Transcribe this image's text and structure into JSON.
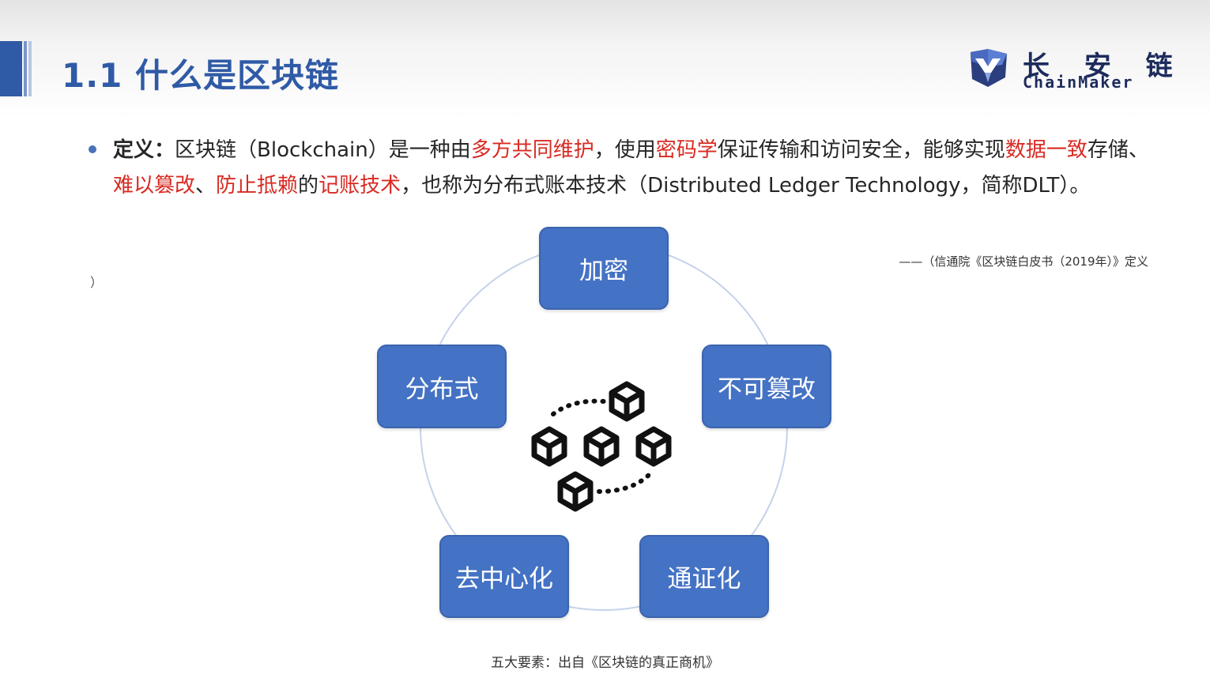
{
  "slide": {
    "title": "1.1 什么是区块链",
    "brand": {
      "name_cn": "长 安 链",
      "name_en": "ChainMaker",
      "logo_icon": "chainmaker-logo-icon",
      "color": "#1d2b5c"
    },
    "accent_color": "#2f5aa6",
    "highlight_color": "#d82a22"
  },
  "definition": {
    "label": "定义：",
    "segments": [
      {
        "text": "区块链（Blockchain）是一种由",
        "highlight": false
      },
      {
        "text": "多方共同维护",
        "highlight": true
      },
      {
        "text": "，使用",
        "highlight": false
      },
      {
        "text": "密码学",
        "highlight": true
      },
      {
        "text": "保证传输和访问安全，能够实现",
        "highlight": false
      },
      {
        "text": "数据一致",
        "highlight": true
      },
      {
        "text": "存储、",
        "highlight": false
      },
      {
        "text": "难以篡改",
        "highlight": true
      },
      {
        "text": "、",
        "highlight": false
      },
      {
        "text": "防止抵赖",
        "highlight": true
      },
      {
        "text": "的",
        "highlight": false
      },
      {
        "text": "记账技术",
        "highlight": true
      },
      {
        "text": "，也称为分布式账本技术（Distributed Ledger Technology，简称DLT）。",
        "highlight": false
      }
    ],
    "source": "——（信通院《区块链白皮书（2019年）》定义",
    "stray_mark": "）"
  },
  "diagram": {
    "center_icon": "blockchain-cubes-icon",
    "node_color": "#4472c4",
    "elements": [
      "加密",
      "不可篡改",
      "通证化",
      "去中心化",
      "分布式"
    ],
    "caption": "五大要素：出自《区块链的真正商机》"
  }
}
